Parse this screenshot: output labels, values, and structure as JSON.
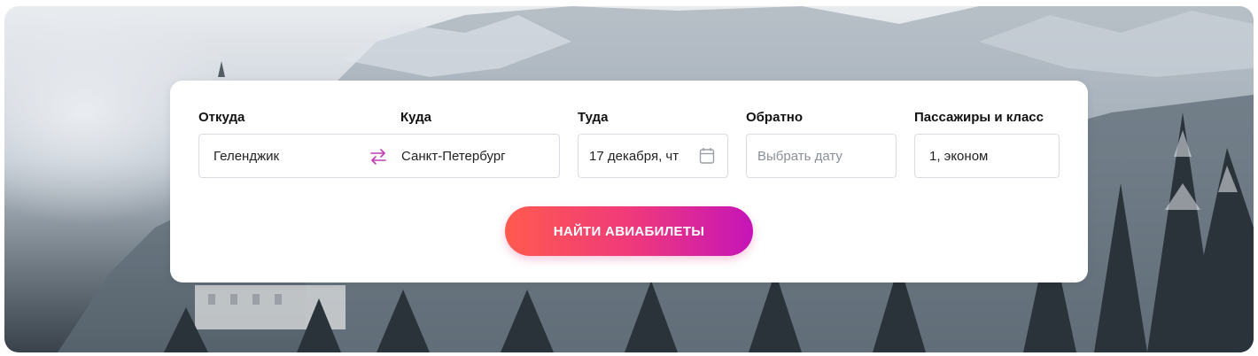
{
  "search_form": {
    "origin": {
      "label": "Откуда",
      "value": "Геленджик"
    },
    "destination": {
      "label": "Куда",
      "value": "Санкт-Петербург"
    },
    "depart": {
      "label": "Туда",
      "value": "17 декабря, чт"
    },
    "return": {
      "label": "Обратно",
      "placeholder": "Выбрать дату"
    },
    "passengers": {
      "label": "Пассажиры и класс",
      "value": "1, эконом"
    },
    "submit_label": "НАЙТИ АВИАБИЛЕТЫ"
  },
  "icons": {
    "swap": "swap-arrows-icon",
    "calendar": "calendar-icon"
  },
  "colors": {
    "button_gradient_start": "#ff5a4f",
    "button_gradient_end": "#c514b8",
    "swap_icon": "#c23bb5"
  }
}
